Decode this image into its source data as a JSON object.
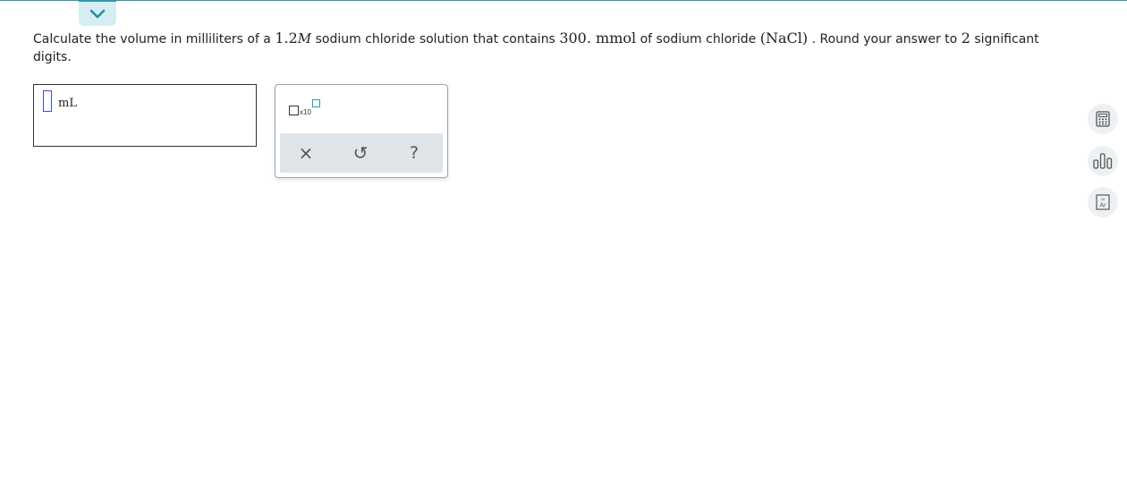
{
  "question": {
    "p1": "Calculate the volume in milliliters of a ",
    "conc_value": "1.2",
    "conc_unit": "M",
    "p2": " sodium chloride solution that contains ",
    "amount": "300. mmol",
    "p3": " of sodium chloride ",
    "formula": "(NaCl)",
    "p4": " . Round your answer to ",
    "sig_figs": "2",
    "p5": " significant digits."
  },
  "answer": {
    "unit": "mL"
  },
  "palette": {
    "x10_label": "x10",
    "clear_glyph": "×",
    "undo_glyph": "↺",
    "help_glyph": "?"
  },
  "colors": {
    "accent": "#2a9bb0",
    "cursor": "#3b4ad6",
    "palette_bg": "#dfe4e8"
  },
  "icons": [
    "chevron-down-icon",
    "calculator-icon",
    "bar-chart-icon",
    "periodic-table-icon"
  ]
}
